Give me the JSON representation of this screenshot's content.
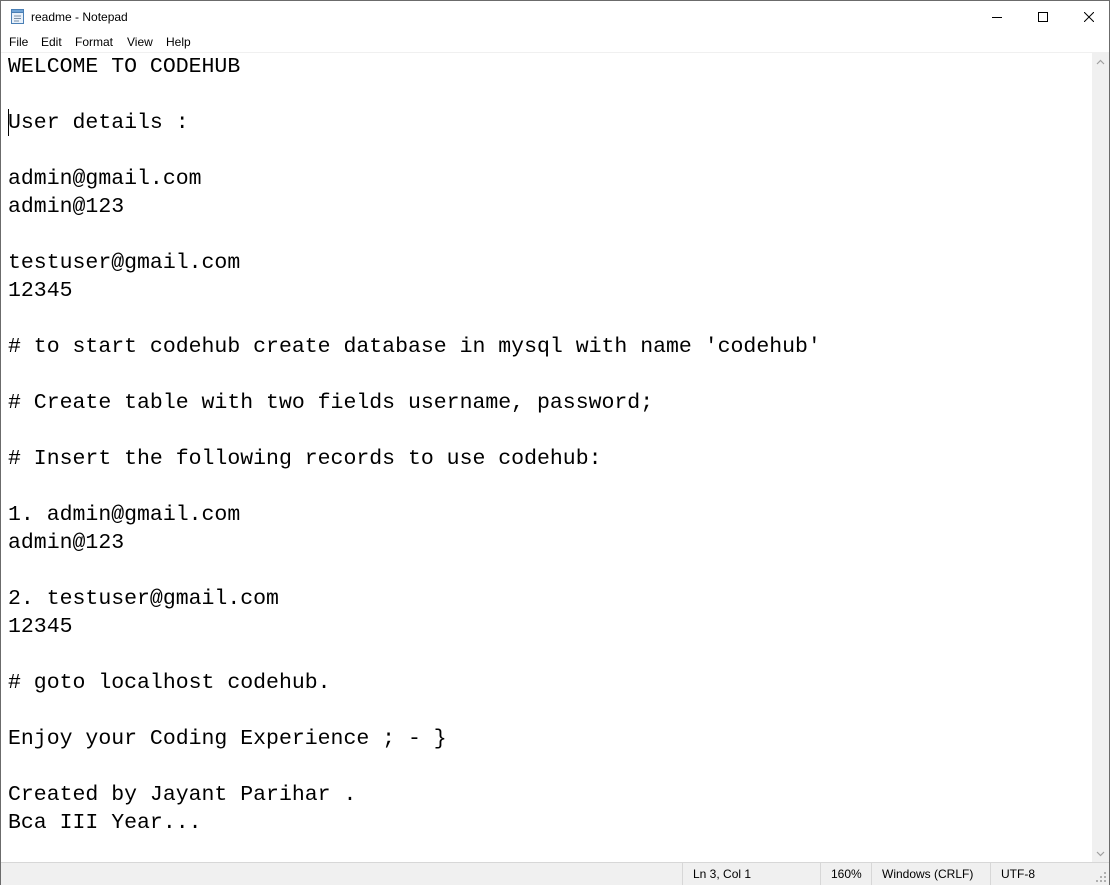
{
  "window": {
    "title": "readme - Notepad",
    "icon": "notepad-icon",
    "controls": {
      "minimize": "minimize-icon",
      "maximize": "maximize-icon",
      "close": "close-icon"
    }
  },
  "menu": {
    "items": [
      "File",
      "Edit",
      "Format",
      "View",
      "Help"
    ]
  },
  "editor": {
    "lines": [
      "WELCOME TO CODEHUB",
      "",
      "User details :",
      "",
      "admin@gmail.com",
      "admin@123",
      "",
      "testuser@gmail.com",
      "12345",
      "",
      "# to start codehub create database in mysql with name 'codehub'",
      "",
      "# Create table with two fields username, password;",
      "",
      "# Insert the following records to use codehub:",
      "",
      "1. admin@gmail.com",
      "admin@123",
      "",
      "2. testuser@gmail.com",
      "12345",
      "",
      "# goto localhost codehub.",
      "",
      "Enjoy your Coding Experience ; - }",
      "",
      "Created by Jayant Parihar .",
      "Bca III Year..."
    ]
  },
  "status": {
    "position": "Ln 3, Col 1",
    "zoom": "160%",
    "line_ending": "Windows (CRLF)",
    "encoding": "UTF-8"
  }
}
